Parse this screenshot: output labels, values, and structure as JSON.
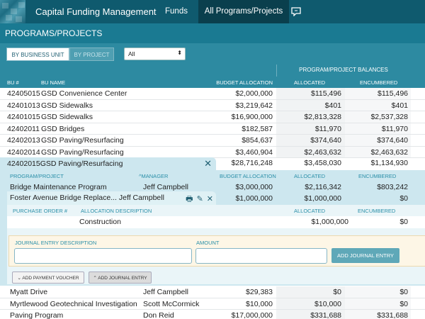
{
  "nav": {
    "app_title": "Capital Funding Management",
    "tabs": [
      {
        "label": "Funds"
      },
      {
        "label": "All Programs/Projects"
      }
    ]
  },
  "page": {
    "title": "PROGRAMS/PROJECTS"
  },
  "toolbar": {
    "view_by_business_unit": "BY BUSINESS UNIT",
    "view_by_project": "BY PROJECT",
    "filter_value": "All"
  },
  "table": {
    "group_header": "PROGRAM/PROJECT BALANCES",
    "columns": {
      "bu": "BU #",
      "name": "BU NAME",
      "budget": "BUDGET ALLOCATION",
      "allocated": "ALLOCATED",
      "encumbered": "ENCUMBERED"
    },
    "rows": [
      {
        "bu": "42405015",
        "name": "GSD Convenience Center",
        "budget": "$2,000,000",
        "allocated": "$115,496",
        "encumbered": "$115,496"
      },
      {
        "bu": "42401013",
        "name": "GSD Sidewalks",
        "budget": "$3,219,642",
        "allocated": "$401",
        "encumbered": "$401"
      },
      {
        "bu": "42401015",
        "name": "GSD Sidewalks",
        "budget": "$16,900,000",
        "allocated": "$2,813,328",
        "encumbered": "$2,537,328"
      },
      {
        "bu": "42402011",
        "name": "GSD Bridges",
        "budget": "$182,587",
        "allocated": "$11,970",
        "encumbered": "$11,970"
      },
      {
        "bu": "42402013",
        "name": "GSD Paving/Resurfacing",
        "budget": "$854,637",
        "allocated": "$374,640",
        "encumbered": "$374,640"
      },
      {
        "bu": "42402014",
        "name": "GSD Paving/Resurfacing",
        "budget": "$3,460,904",
        "allocated": "$2,463,632",
        "encumbered": "$2,463,632"
      }
    ],
    "expanded_row": {
      "bu": "42402015",
      "name": "GSD Paving/Resurfacing",
      "budget": "$28,716,248",
      "allocated": "$3,458,030",
      "encumbered": "$1,134,930"
    }
  },
  "programs": {
    "columns": {
      "program": "PROGRAM/PROJECT",
      "manager": "^MANAGER",
      "budget": "BUDGET ALLOCATION",
      "allocated": "ALLOCATED",
      "encumbered": "ENCUMBERED"
    },
    "rows": [
      {
        "name": "Bridge Maintenance Program",
        "manager": "Jeff Campbell",
        "budget": "$3,000,000",
        "allocated": "$2,116,342",
        "encumbered": "$803,242"
      }
    ],
    "expanded": {
      "name": "Foster Avenue Bridge Replace...",
      "manager": "Jeff Campbell",
      "budget": "$1,000,000",
      "allocated": "$1,000,000",
      "encumbered": "$0"
    },
    "after_rows": [
      {
        "name": "Myatt Drive",
        "manager": "Jeff Campbell",
        "budget": "$29,383",
        "allocated": "$0",
        "encumbered": "$0"
      },
      {
        "name": "Myrtlewood Geotechnical Investigation",
        "manager": "Scott McCormick",
        "budget": "$10,000",
        "allocated": "$10,000",
        "encumbered": "$0"
      },
      {
        "name": "Paving Program",
        "manager": "Don Reid",
        "budget": "$17,000,000",
        "allocated": "$331,688",
        "encumbered": "$331,688"
      }
    ]
  },
  "purchase_orders": {
    "columns": {
      "po": "PURCHASE ORDER #",
      "desc": "ALLOCATION DESCRIPTION",
      "allocated": "ALLOCATED",
      "encumbered": "ENCUMBERED"
    },
    "rows": [
      {
        "desc": "Construction",
        "allocated": "$1,000,000",
        "encumbered": "$0"
      }
    ]
  },
  "journal_entry": {
    "description_label": "JOURNAL ENTRY DESCRIPTION",
    "amount_label": "AMOUNT",
    "description_value": "",
    "amount_value": "",
    "add_button": "ADD JOURNAL ENTRY"
  },
  "actions": {
    "add_payment_voucher": "ADD PAYMENT VOUCHER",
    "add_journal_entry": "ADD JOURNAL ENTRY"
  }
}
